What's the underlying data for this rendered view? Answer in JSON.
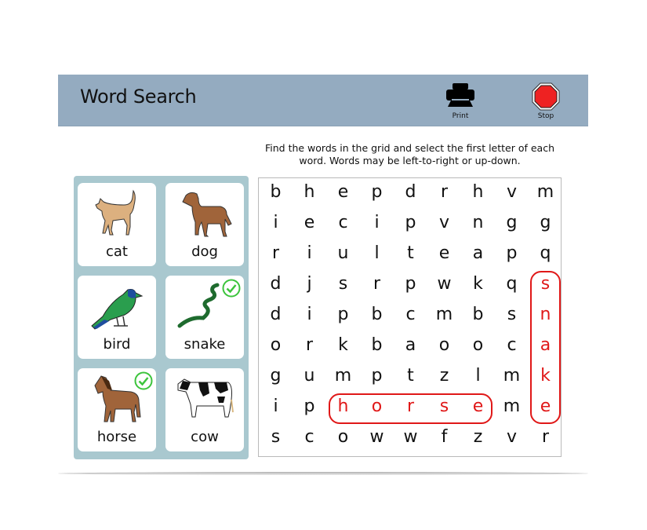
{
  "header": {
    "title": "Word Search",
    "print_label": "Print",
    "print_icon": "printer-icon",
    "stop_label": "Stop",
    "stop_icon": "stop-sign-icon"
  },
  "instructions": "Find the words in the grid and select the first letter of each word. Words may be left-to-right or up-down.",
  "colors": {
    "header_bg": "#94abc0",
    "panel_bg": "#a9c8cf",
    "found_highlight": "#e01818",
    "check_green": "#3cc43c",
    "stop_red": "#ee2222"
  },
  "words": [
    {
      "label": "cat",
      "icon": "cat-icon",
      "found": false
    },
    {
      "label": "dog",
      "icon": "dog-icon",
      "found": false
    },
    {
      "label": "bird",
      "icon": "bird-icon",
      "found": false
    },
    {
      "label": "snake",
      "icon": "snake-icon",
      "found": true
    },
    {
      "label": "horse",
      "icon": "horse-icon",
      "found": true
    },
    {
      "label": "cow",
      "icon": "cow-icon",
      "found": false
    }
  ],
  "grid": [
    [
      "b",
      "h",
      "e",
      "p",
      "d",
      "r",
      "h",
      "v",
      "m"
    ],
    [
      "i",
      "e",
      "c",
      "i",
      "p",
      "v",
      "n",
      "g",
      "g"
    ],
    [
      "r",
      "i",
      "u",
      "l",
      "t",
      "e",
      "a",
      "p",
      "q"
    ],
    [
      "d",
      "j",
      "s",
      "r",
      "p",
      "w",
      "k",
      "q",
      "s"
    ],
    [
      "d",
      "i",
      "p",
      "b",
      "c",
      "m",
      "b",
      "s",
      "n"
    ],
    [
      "o",
      "r",
      "k",
      "b",
      "a",
      "o",
      "o",
      "c",
      "a"
    ],
    [
      "g",
      "u",
      "m",
      "p",
      "t",
      "z",
      "l",
      "m",
      "k"
    ],
    [
      "i",
      "p",
      "h",
      "o",
      "r",
      "s",
      "e",
      "m",
      "e"
    ],
    [
      "s",
      "c",
      "o",
      "w",
      "w",
      "f",
      "z",
      "v",
      "r"
    ]
  ],
  "found_words": [
    {
      "word": "snake",
      "row": 3,
      "col": 8,
      "direction": "down",
      "length": 5
    },
    {
      "word": "horse",
      "row": 7,
      "col": 2,
      "direction": "right",
      "length": 5
    }
  ]
}
